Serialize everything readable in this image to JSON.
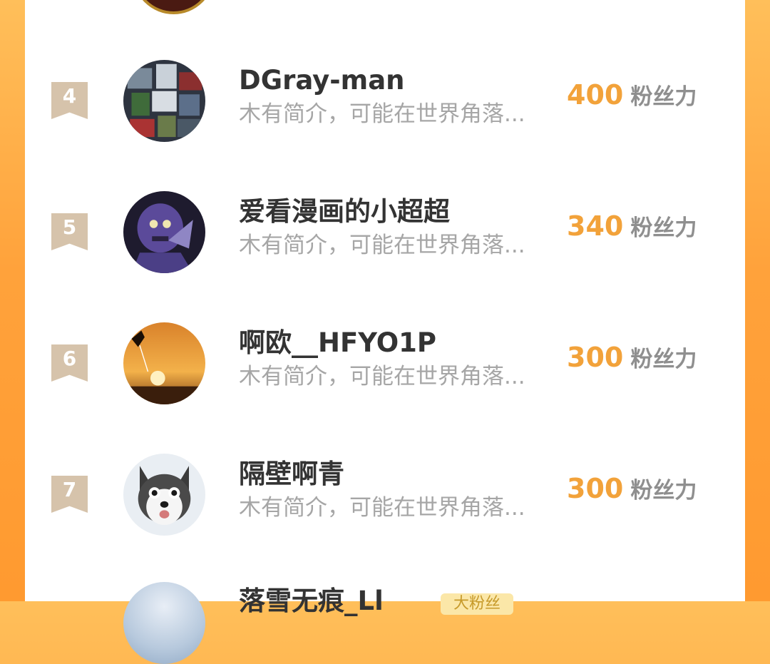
{
  "rows": [
    {
      "rank": "4",
      "name": "DGray-man",
      "desc": "木有简介，可能在世界角落...",
      "fans_value": "400",
      "fans_unit": "粉丝力",
      "avatar_icon": "robot-collage-avatar"
    },
    {
      "rank": "5",
      "name": "爱看漫画的小超超",
      "desc": "木有简介，可能在世界角落...",
      "fans_value": "340",
      "fans_unit": "粉丝力",
      "avatar_icon": "purple-anime-character-avatar"
    },
    {
      "rank": "6",
      "name": "啊欧__HFYO1P",
      "desc": "木有简介，可能在世界角落...",
      "fans_value": "300",
      "fans_unit": "粉丝力",
      "avatar_icon": "sunset-climber-avatar"
    },
    {
      "rank": "7",
      "name": "隔壁啊青",
      "desc": "木有简介，可能在世界角落...",
      "fans_value": "300",
      "fans_unit": "粉丝力",
      "avatar_icon": "husky-dog-avatar"
    }
  ],
  "partial_bottom": {
    "name": "落雪无痕_Ll",
    "tag": "大粉丝"
  },
  "colors": {
    "accent": "#f2a23a",
    "badge": "#d6c3ab",
    "background": "#ffa23b"
  }
}
